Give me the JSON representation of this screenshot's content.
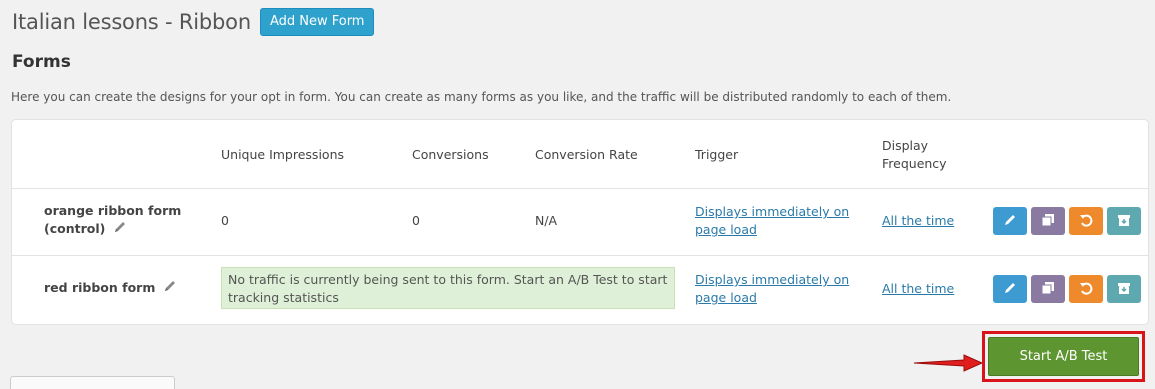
{
  "header": {
    "title": "Italian lessons - Ribbon",
    "add_button": "Add New Form"
  },
  "section": {
    "title": "Forms",
    "description": "Here you can create the designs for your opt in form. You can create as many forms as you like, and the traffic will be distributed randomly to each of them."
  },
  "table": {
    "columns": [
      "Unique Impressions",
      "Conversions",
      "Conversion Rate",
      "Trigger",
      "Display Frequency"
    ],
    "rows": [
      {
        "name": "orange ribbon form",
        "name2": "(control)",
        "impressions": "0",
        "conversions": "0",
        "rate": "N/A",
        "trigger1": "Displays immediately on",
        "trigger2": "page load",
        "frequency": "All the time"
      },
      {
        "name": "red ribbon form",
        "notice1": "No traffic is currently being sent to this form. Start an A/B Test to start",
        "notice2": "tracking statistics",
        "trigger1": "Displays immediately on",
        "trigger2": "page load",
        "frequency": "All the time"
      }
    ]
  },
  "icons": {
    "edit": "pencil-icon",
    "copy": "copy-icon",
    "reset": "undo-icon",
    "archive": "archive-icon"
  },
  "colors": {
    "accent": "#2ea2cc",
    "green": "#5d9630",
    "highlight": "#d9131a"
  },
  "ab_test": {
    "label": "Start A/B Test"
  }
}
